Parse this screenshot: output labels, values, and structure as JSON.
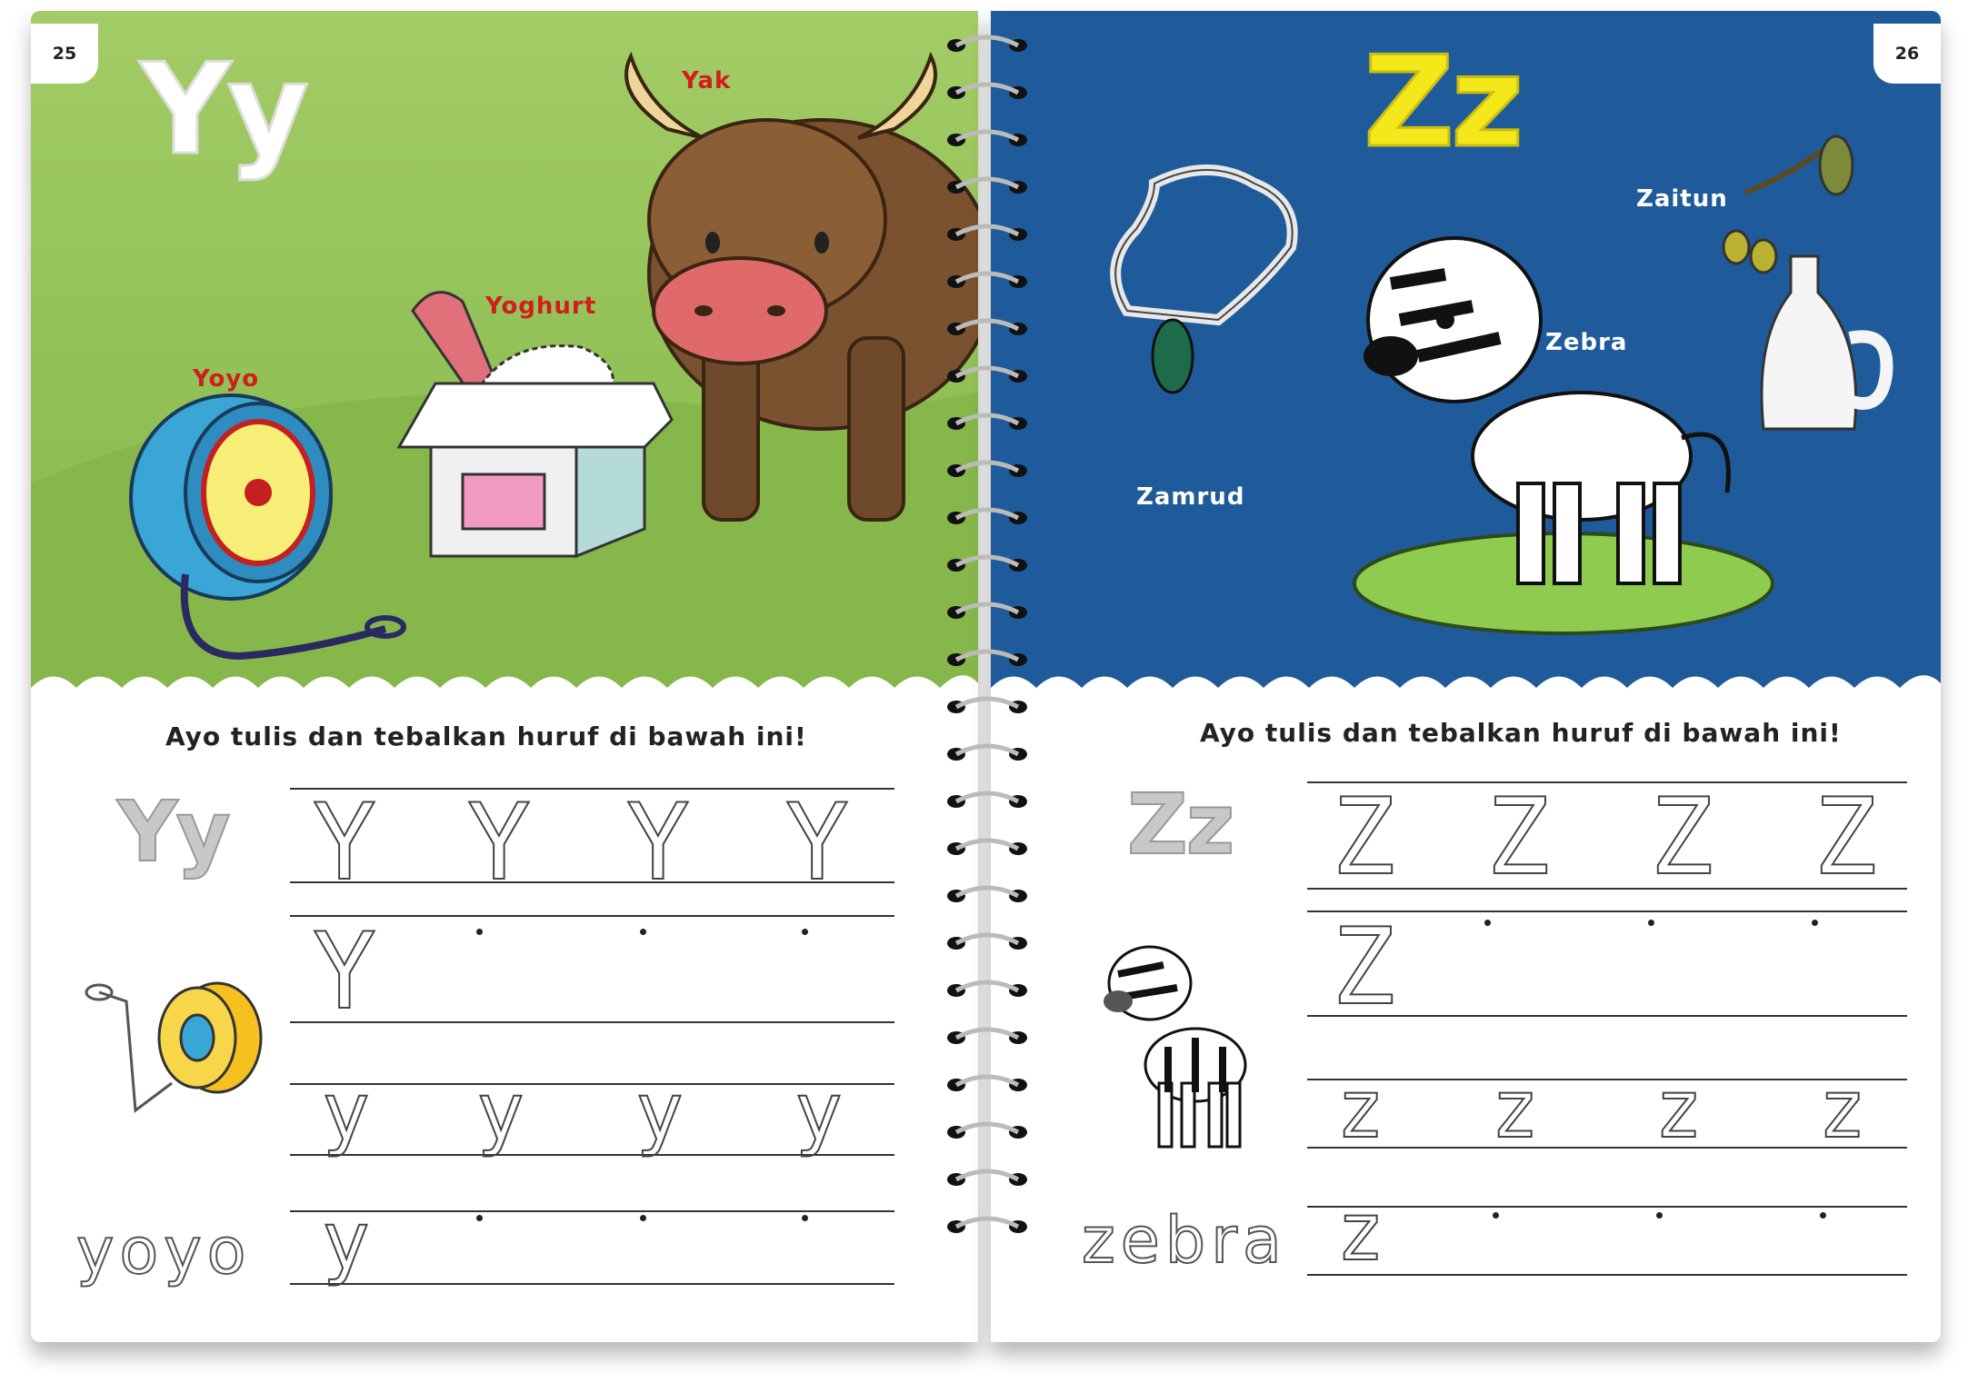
{
  "left_page": {
    "page_number": "25",
    "letter_pair": "Yy",
    "labels": {
      "yak": "Yak",
      "yoghurt": "Yoghurt",
      "yoyo": "Yoyo"
    },
    "instruction": "Ayo tulis dan tebalkan huruf di bawah ini!",
    "side_letters": "Yy",
    "word": "yoyo",
    "uppercase_trace": "Y",
    "lowercase_trace": "y"
  },
  "right_page": {
    "page_number": "26",
    "letter_pair": "Zz",
    "labels": {
      "zaitun": "Zaitun",
      "zebra": "Zebra",
      "zamrud": "Zamrud"
    },
    "instruction": "Ayo tulis dan tebalkan huruf di bawah ini!",
    "side_letters": "Zz",
    "word": "zebra",
    "uppercase_trace": "Z",
    "lowercase_trace": "z"
  },
  "colors": {
    "left_scene": "#97c45c",
    "right_scene": "#1f5b9b",
    "label_red": "#d21d1d",
    "big_letter_yellow": "#f4e81a"
  },
  "icons": [
    "yak-illustration",
    "yoghurt-illustration",
    "yoyo-illustration",
    "necklace-illustration",
    "zebra-illustration",
    "olive-vase-illustration",
    "spiral-binding"
  ]
}
